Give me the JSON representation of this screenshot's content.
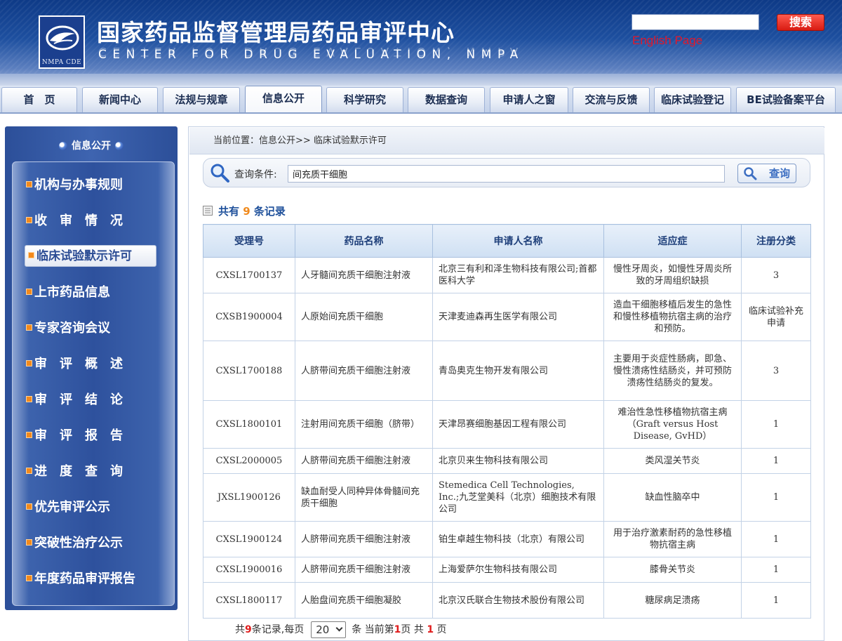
{
  "header": {
    "logo_text": "NMPA CDE",
    "title": "国家药品监督管理局药品审评中心",
    "subtitle": "CENTER FOR DRUG EVALUATION, NMPA",
    "search_value": "",
    "search_button": "搜索",
    "english_link": "English Page"
  },
  "nav": {
    "tabs": [
      {
        "label": "首　页"
      },
      {
        "label": "新闻中心"
      },
      {
        "label": "法规与规章"
      },
      {
        "label": "信息公开"
      },
      {
        "label": "科学研究"
      },
      {
        "label": "数据查询"
      },
      {
        "label": "申请人之窗"
      },
      {
        "label": "交流与反馈"
      },
      {
        "label": "临床试验登记"
      },
      {
        "label": "BE试验备案平台"
      }
    ]
  },
  "sidebar": {
    "title": "信息公开",
    "items": [
      {
        "label": "机构与办事规则"
      },
      {
        "label": "收审情况"
      },
      {
        "label": "临床试验默示许可"
      },
      {
        "label": "上市药品信息"
      },
      {
        "label": "专家咨询会议"
      },
      {
        "label": "审评概述"
      },
      {
        "label": "审评结论"
      },
      {
        "label": "审评报告"
      },
      {
        "label": "进度查询"
      },
      {
        "label": "优先审评公示"
      },
      {
        "label": "突破性治疗公示"
      },
      {
        "label": "年度药品审评报告"
      }
    ]
  },
  "main": {
    "breadcrumb": "当前位置：信息公开>> 临床试验默示许可",
    "query_label": "查询条件:",
    "query_value": "间充质干细胞",
    "query_button": "查询",
    "record_prefix": "共有",
    "record_count": "9",
    "record_suffix": "条记录",
    "table": {
      "headers": [
        "受理号",
        "药品名称",
        "申请人名称",
        "适应症",
        "注册分类"
      ],
      "rows": [
        {
          "id": "CXSL1700137",
          "drug": "人牙髓间充质干细胞注射液",
          "applicant": "北京三有利和泽生物科技有限公司;首都医科大学",
          "indication": "慢性牙周炎，如慢性牙周炎所致的牙周组织缺损",
          "category": "3"
        },
        {
          "id": "CXSB1900004",
          "drug": "人原始间充质干细胞",
          "applicant": "天津麦迪森再生医学有限公司",
          "indication": "造血干细胞移植后发生的急性和慢性移植物抗宿主病的治疗和预防。",
          "category": "临床试验补充申请"
        },
        {
          "id": "CXSL1700188",
          "drug": "人脐带间充质干细胞注射液",
          "applicant": "青岛奥克生物开发有限公司",
          "indication": "主要用于炎症性肠病，即急、慢性溃疡性结肠炎，并可预防溃疡性结肠炎的复发。",
          "category": "3"
        },
        {
          "id": "CXSL1800101",
          "drug": "注射用间充质干细胞（脐带）",
          "applicant": "天津昂赛细胞基因工程有限公司",
          "indication": "难治性急性移植物抗宿主病（Graft versus Host Disease, GvHD）",
          "category": "1"
        },
        {
          "id": "CXSL2000005",
          "drug": "人脐带间充质干细胞注射液",
          "applicant": "北京贝来生物科技有限公司",
          "indication": "类风湿关节炎",
          "category": "1"
        },
        {
          "id": "JXSL1900126",
          "drug": "缺血耐受人同种异体骨髓间充质干细胞",
          "applicant": "Stemedica Cell Technologies, Inc.;九芝堂美科（北京）细胞技术有限公司",
          "indication": "缺血性脑卒中",
          "category": "1"
        },
        {
          "id": "CXSL1900124",
          "drug": "人脐带间充质干细胞注射液",
          "applicant": "铂生卓越生物科技（北京）有限公司",
          "indication": "用于治疗激素耐药的急性移植物抗宿主病",
          "category": "1"
        },
        {
          "id": "CXSL1900016",
          "drug": "人脐带间充质干细胞注射液",
          "applicant": "上海爱萨尔生物科技有限公司",
          "indication": "膝骨关节炎",
          "category": "1"
        },
        {
          "id": "CXSL1800117",
          "drug": "人胎盘间充质干细胞凝胶",
          "applicant": "北京汉氏联合生物技术股份有限公司",
          "indication": "糖尿病足溃疡",
          "category": "1"
        }
      ]
    },
    "pager": {
      "total_prefix": "共",
      "total": "9",
      "total_suffix": "条记录,每页",
      "page_size": "20",
      "page_size_suffix": "条 当前第",
      "current": "1",
      "page_mid": "页 共",
      "pages": "1",
      "page_end": "页"
    }
  },
  "colors": {
    "header_blue": "#1d4f9f",
    "search_red": "#d81b12",
    "english_red": "#e3182a",
    "title_blue": "#1d4f9a",
    "count_orange": "#f08a1d"
  }
}
